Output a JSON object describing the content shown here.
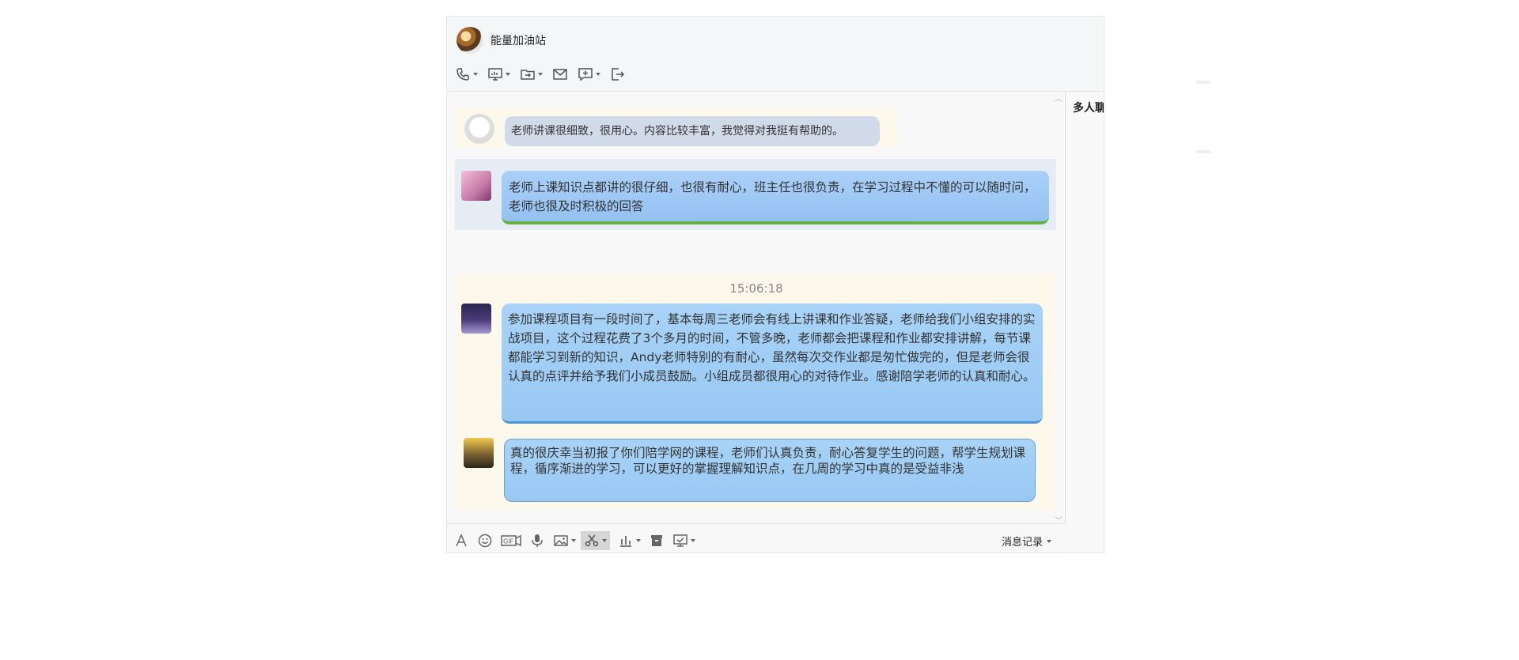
{
  "window": {
    "group_name": "能量加油站",
    "side_panel_title": "多人聊"
  },
  "toolbar": {
    "items": [
      "phone-icon",
      "screen-share-icon",
      "file-transfer-icon",
      "mail-icon",
      "message-add-icon",
      "exit-icon"
    ]
  },
  "chat": {
    "messages": [
      {
        "text": "老师讲课很细致，很用心。内容比较丰富，我觉得对我挺有帮助的。"
      },
      {
        "text": "老师上课知识点都讲的很仔细，也很有耐心，班主任也很负责，在学习过程中不懂的可以随时问，老师也很及时积极的回答"
      },
      {
        "text": "参加课程项目有一段时间了，基本每周三老师会有线上讲课和作业答疑，老师给我们小组安排的实战项目，这个过程花费了3个多月的时间，不管多晚，老师都会把课程和作业都安排讲解，每节课都能学习到新的知识，Andy老师特别的有耐心，虽然每次交作业都是匆忙做完的，但是老师会很认真的点评并给予我们小成员鼓励。小组成员都很用心的对待作业。感谢陪学老师的认真和耐心。"
      },
      {
        "text": "真的很庆幸当初报了你们陪学网的课程，老师们认真负责，耐心答复学生的问题，帮学生规划课程，循序渐进的学习，可以更好的掌握理解知识点，在几周的学习中真的是受益非浅"
      }
    ],
    "timestamp": "15:06:18"
  },
  "input_toolbar": {
    "items": [
      "font-icon",
      "emoji-icon",
      "gif-icon",
      "voice-icon",
      "image-icon",
      "screenshot-icon",
      "vote-icon",
      "delete-icon",
      "more-icon"
    ],
    "history_label": "消息记录"
  },
  "colors": {
    "bubble_blue": "#98c8f3",
    "bubble_gray": "#d0dae8",
    "accent_green": "#66b248"
  }
}
